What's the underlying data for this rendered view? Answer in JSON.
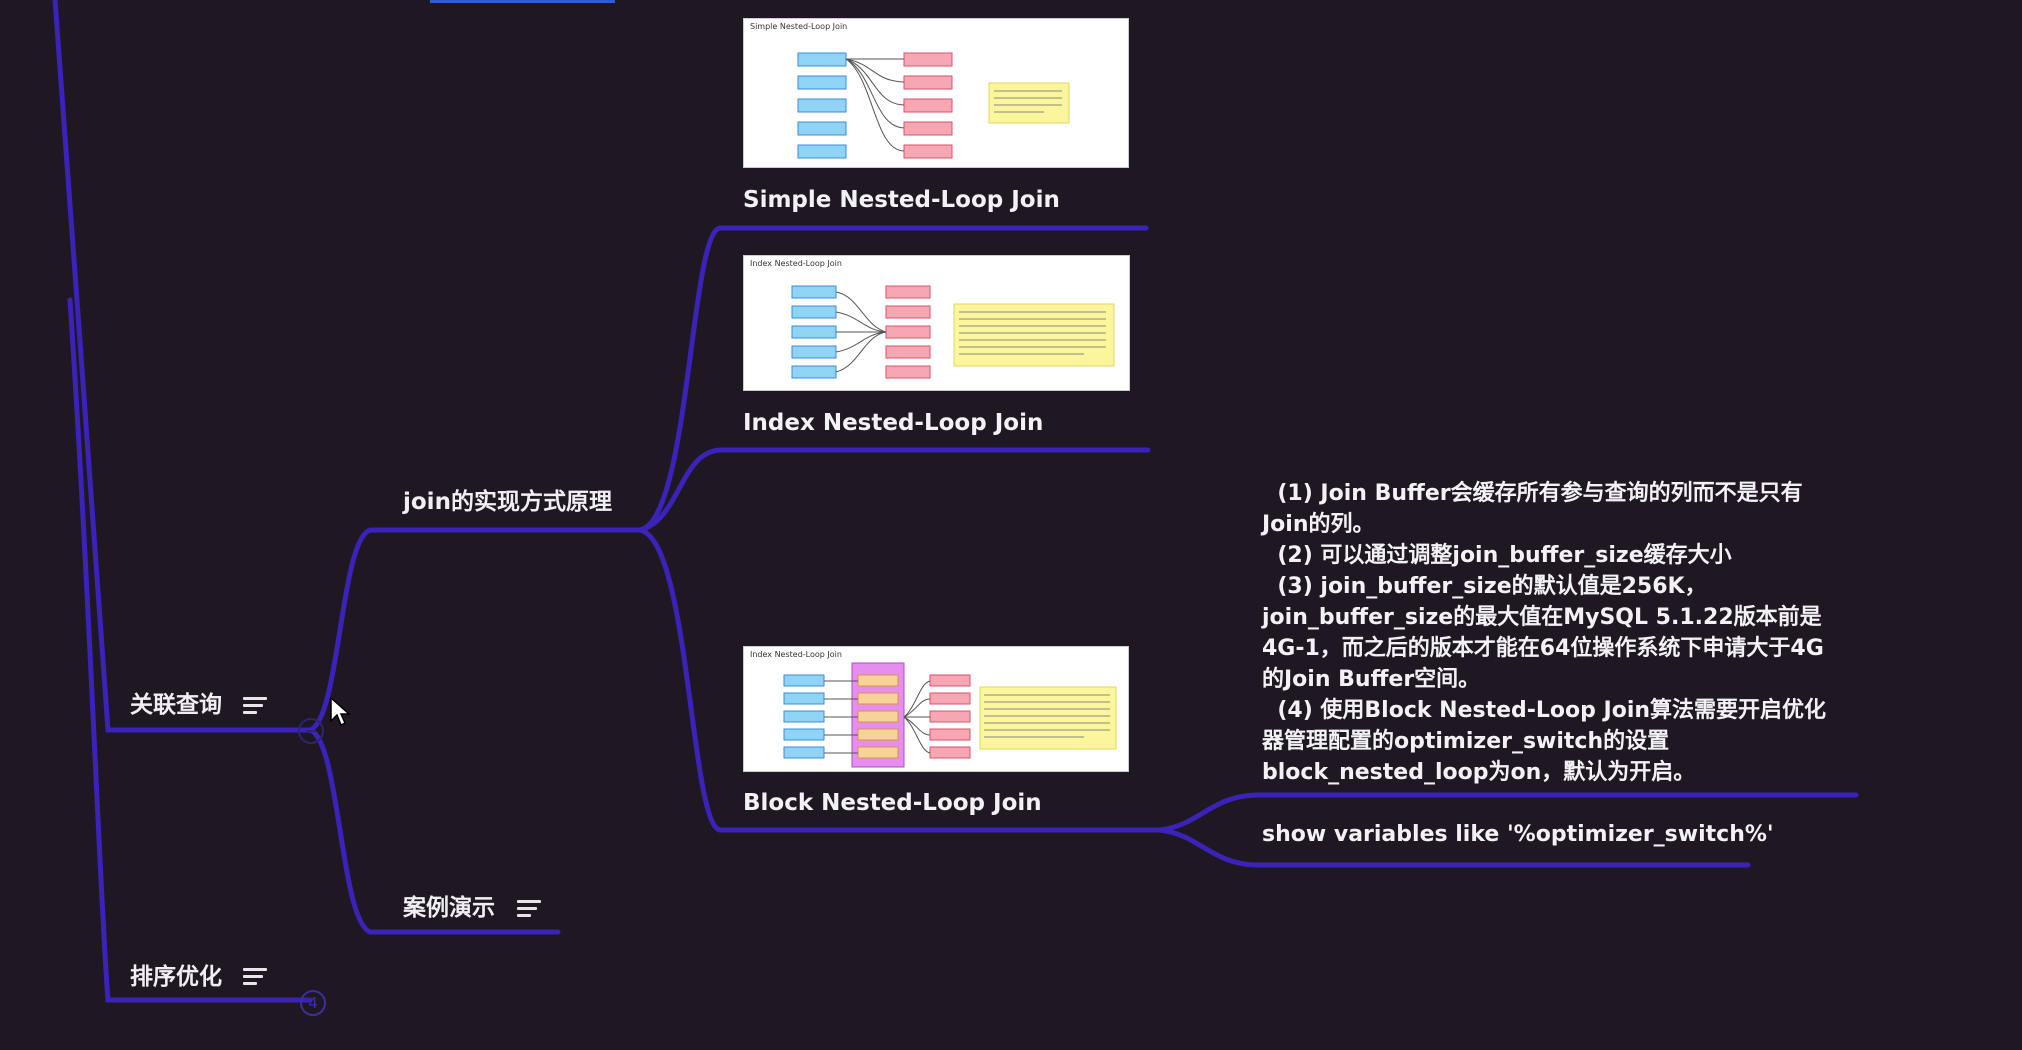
{
  "colors": {
    "background": "#1f1822",
    "branch_line": "#3b22b8",
    "text": "#f3f1f5"
  },
  "nodes": {
    "guanlian": "关联查询",
    "join_principle": "join的实现方式原理",
    "case_demo": "案例演示",
    "sort_opt": "排序优化",
    "collapsed_count": "4"
  },
  "images": {
    "simple": {
      "caption": "Simple Nested-Loop Join",
      "thumb_title": "Simple Nested-Loop Join"
    },
    "index": {
      "caption": "Index Nested-Loop Join",
      "thumb_title": "Index Nested-Loop Join"
    },
    "block": {
      "caption": "Block Nested-Loop Join",
      "thumb_title": "Index Nested-Loop Join"
    }
  },
  "notes": [
    "  (1) Join Buffer会缓存所有参与查询的列而不是只有Join的列。",
    "  (2) 可以通过调整join_buffer_size缓存大小",
    "  (3) join_buffer_size的默认值是256K，join_buffer_size的最大值在MySQL 5.1.22版本前是4G-1，而之后的版本才能在64位操作系统下申请大于4G的Join Buffer空间。",
    "  (4) 使用Block Nested-Loop Join算法需要开启优化器管理配置的optimizer_switch的设置block_nested_loop为on，默认为开启。"
  ],
  "command": "show variables like '%optimizer_switch%'",
  "icons": [
    "note-icon",
    "cursor-icon",
    "collapse-icon"
  ]
}
